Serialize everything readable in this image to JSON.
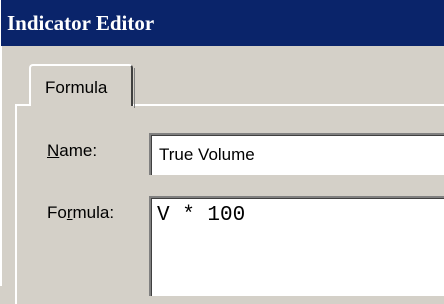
{
  "window": {
    "title": "Indicator Editor"
  },
  "tabs": [
    {
      "label": "Formula",
      "selected": true
    }
  ],
  "form": {
    "name_label_mnemonic": "N",
    "name_label_rest": "ame:",
    "name_value": "True Volume",
    "formula_label_pre": "Fo",
    "formula_label_mnemonic": "r",
    "formula_label_rest": "mula:",
    "formula_value": "V * 100"
  },
  "colors": {
    "titlebar": "#0a246a",
    "face": "#d4d0c8",
    "field": "#ffffff"
  }
}
